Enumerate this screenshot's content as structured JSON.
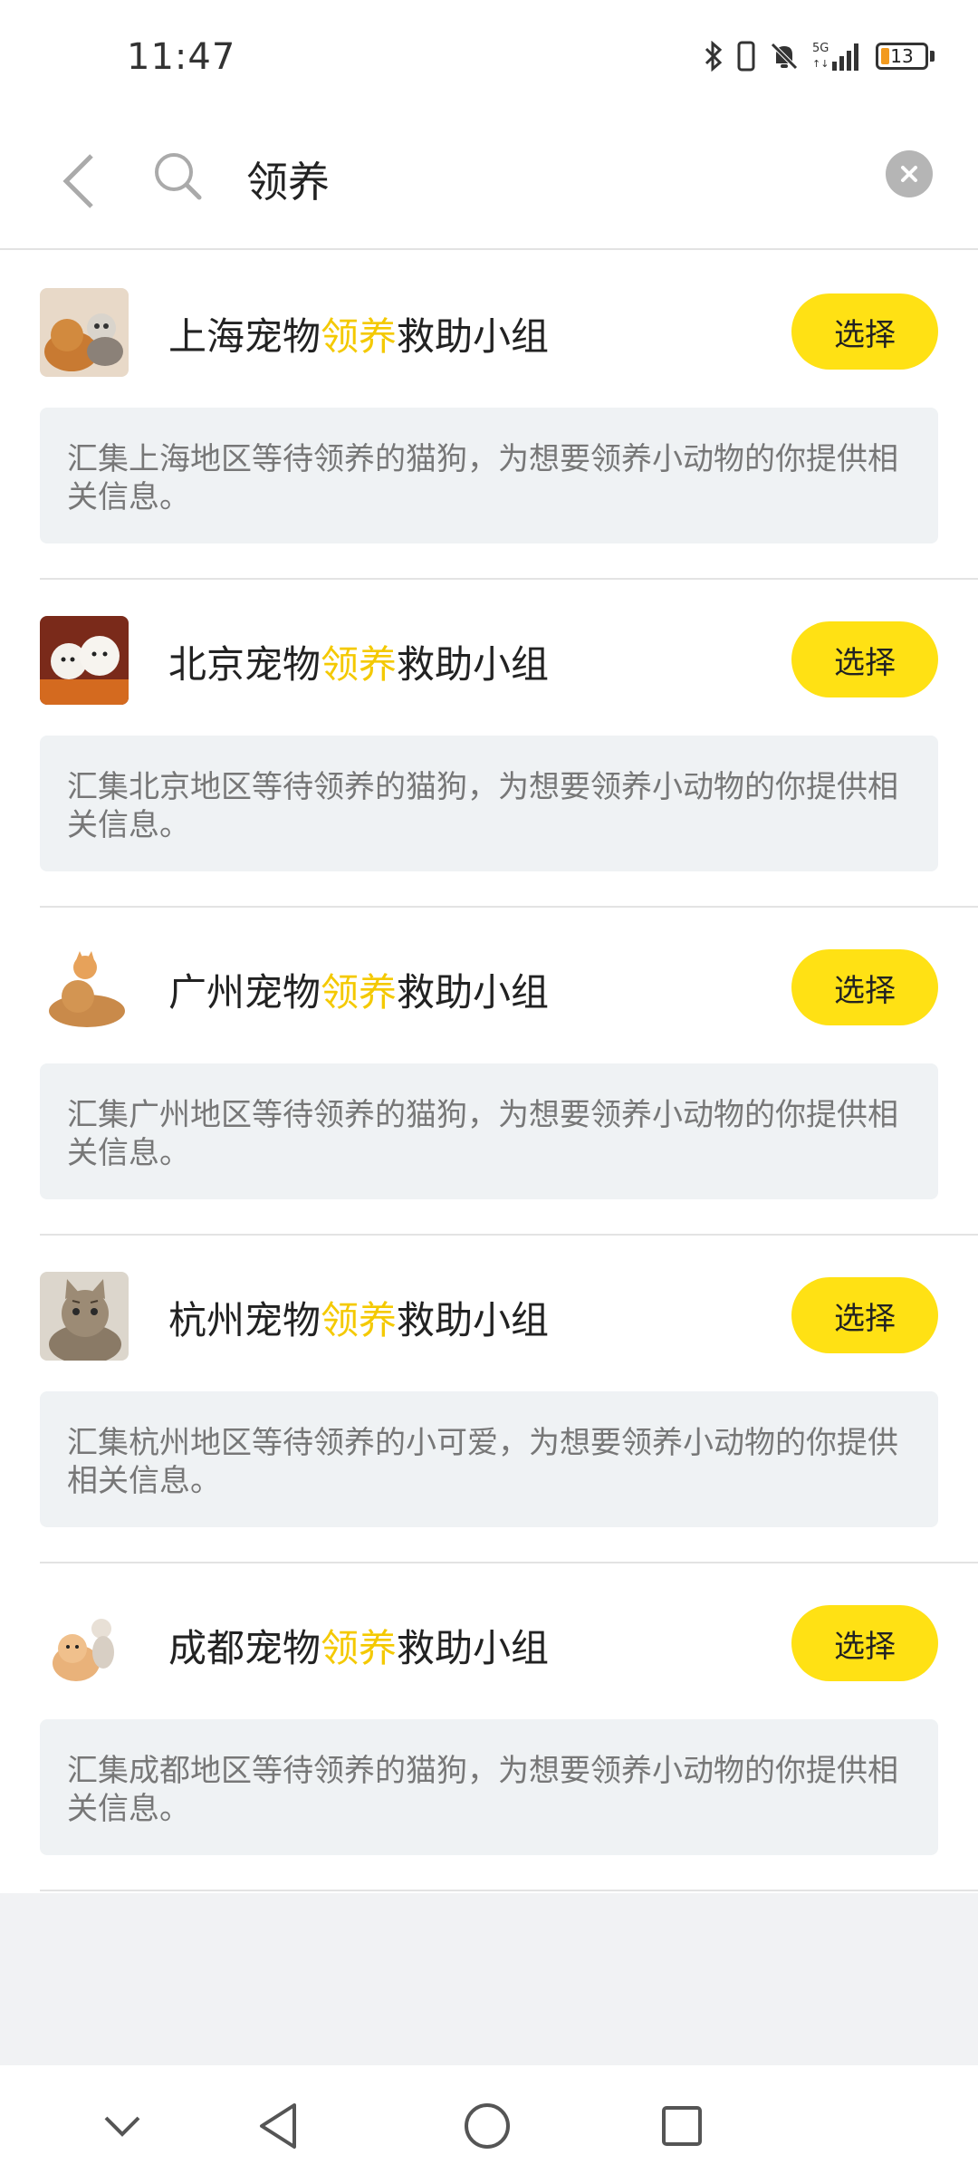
{
  "status_bar": {
    "time": "11:47",
    "battery": "13",
    "icons": [
      "bluetooth-icon",
      "vibrate-icon",
      "mute-bell-icon",
      "signal-5g-icon",
      "battery-icon"
    ]
  },
  "search": {
    "query": "领养",
    "back_icon": "chevron-left-icon",
    "search_icon": "magnifier-icon",
    "clear_icon": "clear-x-icon"
  },
  "highlight_color": "#f4c900",
  "button_color": "#ffe114",
  "results": [
    {
      "title_prefix": "上海宠物",
      "title_highlight": "领养",
      "title_suffix": "救助小组",
      "button": "选择",
      "description": "汇集上海地区等待领养的猫狗，为想要领养小动物的你提供相关信息。",
      "thumb": "dog-and-cat-photo"
    },
    {
      "title_prefix": "北京宠物",
      "title_highlight": "领养",
      "title_suffix": "救助小组",
      "button": "选择",
      "description": "汇集北京地区等待领养的猫狗，为想要领养小动物的你提供相关信息。",
      "thumb": "white-puppies-photo"
    },
    {
      "title_prefix": "广州宠物",
      "title_highlight": "领养",
      "title_suffix": "救助小组",
      "button": "选择",
      "description": "汇集广州地区等待领养的猫狗，为想要领养小动物的你提供相关信息。",
      "thumb": "kitten-and-puppy-photo"
    },
    {
      "title_prefix": "杭州宠物",
      "title_highlight": "领养",
      "title_suffix": "救助小组",
      "button": "选择",
      "description": "汇集杭州地区等待领养的小可爱，为想要领养小动物的你提供相关信息。",
      "thumb": "tabby-cat-photo"
    },
    {
      "title_prefix": "成都宠物",
      "title_highlight": "领养",
      "title_suffix": "救助小组",
      "button": "选择",
      "description": "汇集成都地区等待领养的猫狗，为想要领养小动物的你提供相关信息。",
      "thumb": "pomeranian-and-kitten-photo"
    }
  ],
  "nav_bar": {
    "items": [
      "collapse-chevron-icon",
      "back-triangle-icon",
      "home-circle-icon",
      "recents-square-icon"
    ]
  }
}
